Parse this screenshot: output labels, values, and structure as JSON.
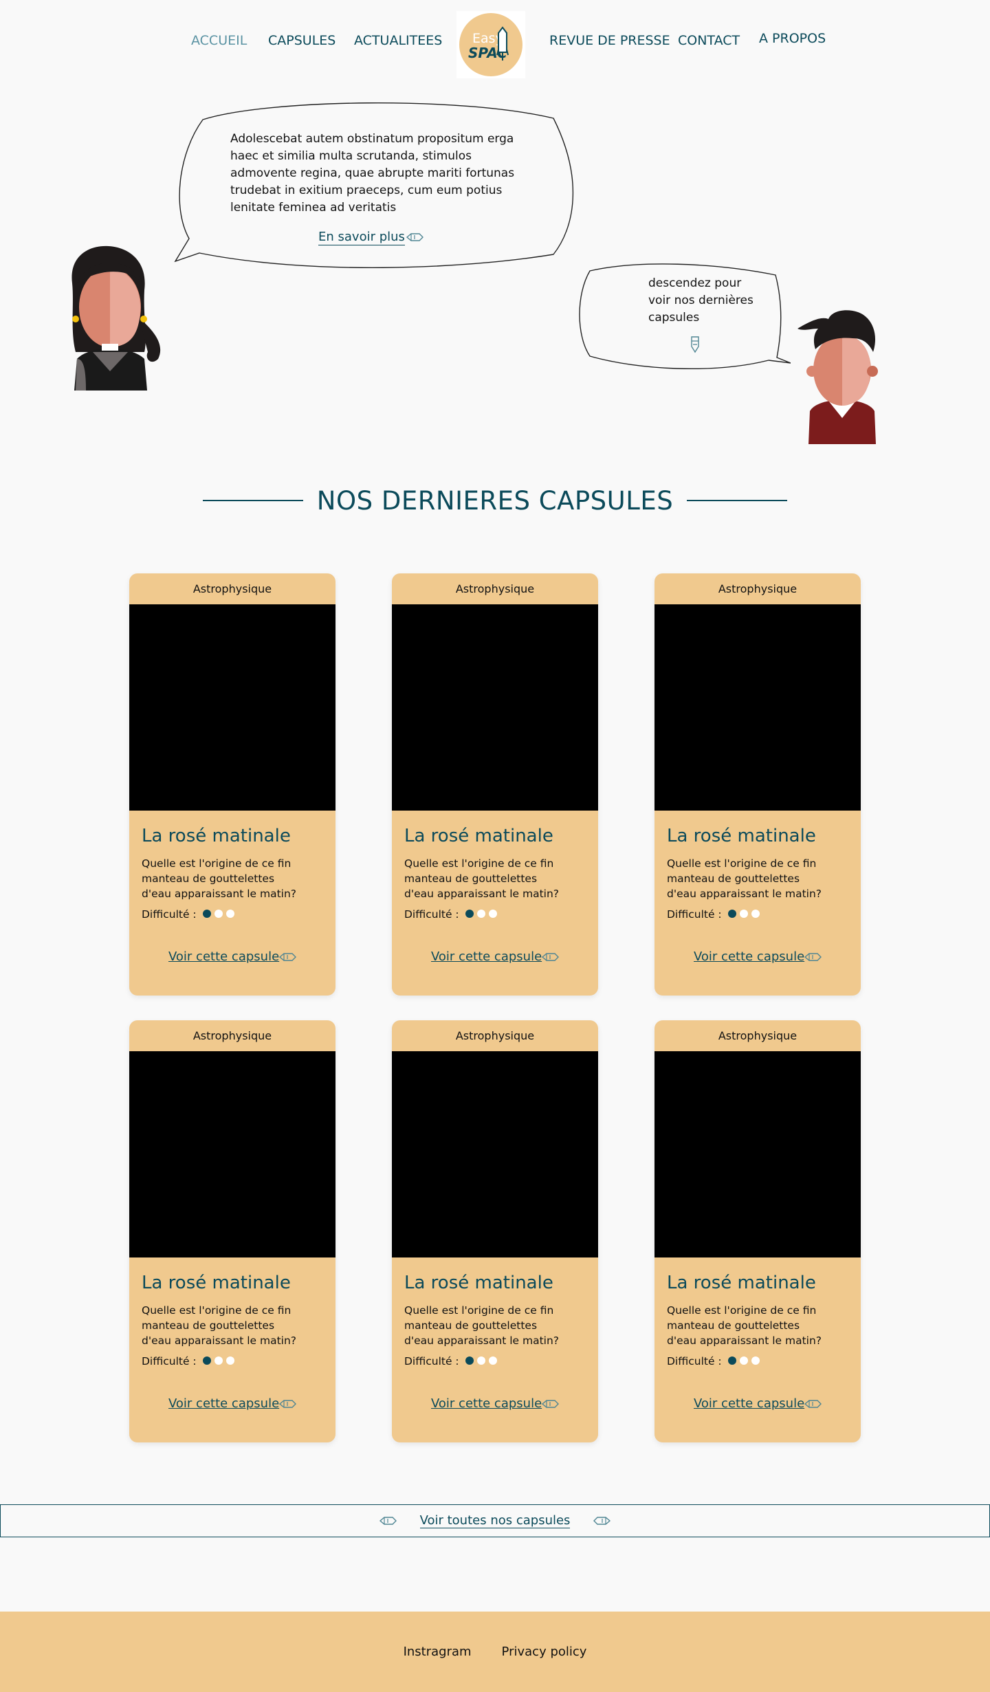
{
  "nav": {
    "left": [
      "ACCUEIL",
      "CAPSULES",
      "ACTUALITEES"
    ],
    "right": [
      "REVUE DE PRESSE",
      "CONTACT",
      "A PROPOS"
    ],
    "logo_top": "Easy",
    "logo_bottom": "SPAC"
  },
  "hero": {
    "main_text": "Adolescebat autem obstinatum propositum erga haec et similia multa scrutanda, stimulos admovente regina, quae abrupte mariti fortunas trudebat in exitium praeceps, cum eum potius lenitate feminea ad veritatis",
    "more_label": "En savoir plus",
    "scroll_text": "descendez pour voir nos dernières capsules"
  },
  "section": {
    "title": "NOS DERNIERES CAPSULES"
  },
  "cards": [
    {
      "category": "Astrophysique",
      "title": "La rosé matinale",
      "desc": "Quelle est l'origine de ce fin manteau de gouttelettes d'eau apparaissant le matin?",
      "difficulty_label": "Difficulté :",
      "difficulty": 1,
      "link": "Voir cette capsule"
    },
    {
      "category": "Astrophysique",
      "title": "La rosé matinale",
      "desc": "Quelle est l'origine de ce fin manteau de gouttelettes d'eau apparaissant le matin?",
      "difficulty_label": "Difficulté :",
      "difficulty": 1,
      "link": "Voir cette capsule"
    },
    {
      "category": "Astrophysique",
      "title": "La rosé matinale",
      "desc": "Quelle est l'origine de ce fin manteau de gouttelettes d'eau apparaissant le matin?",
      "difficulty_label": "Difficulté :",
      "difficulty": 1,
      "link": "Voir cette capsule"
    },
    {
      "category": "Astrophysique",
      "title": "La rosé matinale",
      "desc": "Quelle est l'origine de ce fin manteau de gouttelettes d'eau apparaissant le matin?",
      "difficulty_label": "Difficulté :",
      "difficulty": 1,
      "link": "Voir cette capsule"
    },
    {
      "category": "Astrophysique",
      "title": "La rosé matinale",
      "desc": "Quelle est l'origine de ce fin manteau de gouttelettes d'eau apparaissant le matin?",
      "difficulty_label": "Difficulté :",
      "difficulty": 1,
      "link": "Voir cette capsule"
    },
    {
      "category": "Astrophysique",
      "title": "La rosé matinale",
      "desc": "Quelle est l'origine de ce fin manteau de gouttelettes d'eau apparaissant le matin?",
      "difficulty_label": "Difficulté :",
      "difficulty": 1,
      "link": "Voir cette capsule"
    }
  ],
  "view_all": {
    "label": "Voir toutes nos capsules"
  },
  "footer": {
    "links": [
      "Instragram",
      "Privacy policy"
    ]
  },
  "colors": {
    "primary": "#0b4a5a",
    "accent": "#f0c98e",
    "background": "#f9f9f9",
    "nav_active": "#5b93a3"
  }
}
